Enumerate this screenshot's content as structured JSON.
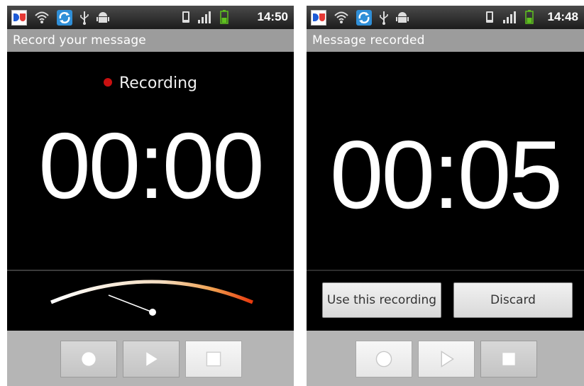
{
  "screens": [
    {
      "status_time": "14:50",
      "title": "Record your message",
      "status_text": "Recording",
      "timer": "00:00",
      "controls": {
        "record": "record-icon",
        "play": "play-icon",
        "stop": "stop-icon"
      }
    },
    {
      "status_time": "14:48",
      "title": "Message recorded",
      "timer": "00:05",
      "use_button_label": "Use this recording",
      "discard_button_label": "Discard",
      "controls": {
        "record": "record-icon",
        "play": "play-icon",
        "stop": "stop-icon"
      }
    }
  ],
  "colors": {
    "recording_dot": "#c91010",
    "title_bar": "#9c9c9c",
    "button_bar": "#b5b5b5",
    "background": "#000000"
  }
}
